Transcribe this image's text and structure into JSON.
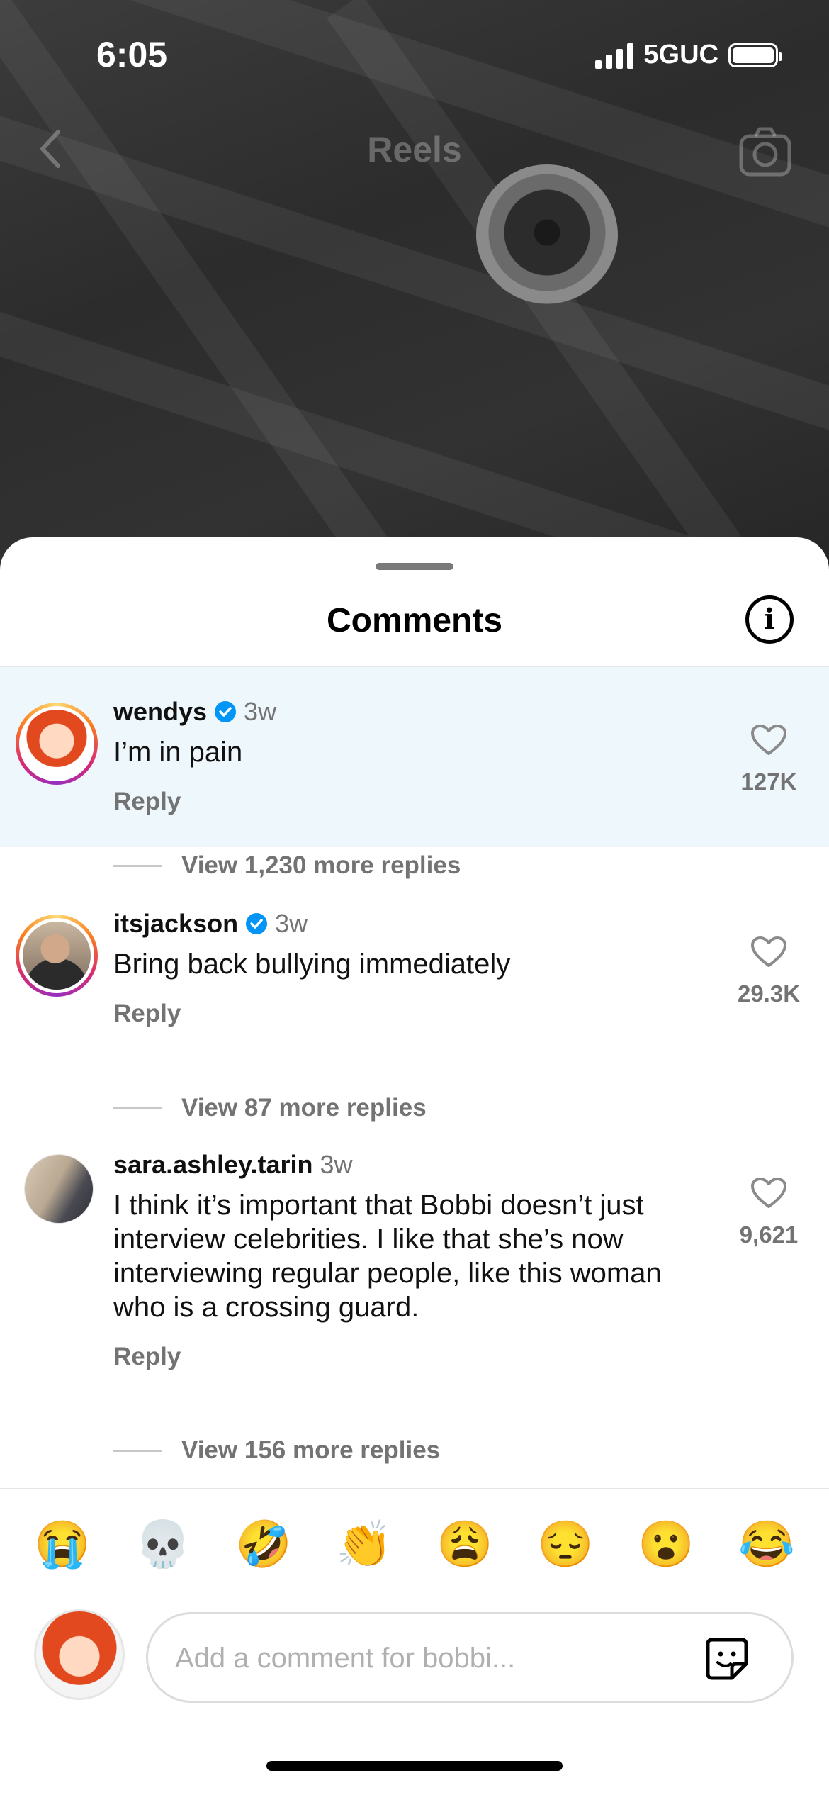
{
  "status_bar": {
    "time": "6:05",
    "network": "5GUC"
  },
  "header": {
    "title": "Reels"
  },
  "sheet": {
    "title": "Comments",
    "comments": [
      {
        "username": "wendys",
        "verified": true,
        "time": "3w",
        "text": "I’m in pain",
        "reply_label": "Reply",
        "likes": "127K",
        "view_more": "View 1,230 more replies"
      },
      {
        "username": "itsjackson",
        "verified": true,
        "time": "3w",
        "text": "Bring back bullying immediately",
        "reply_label": "Reply",
        "likes": "29.3K",
        "view_more": "View 87 more replies"
      },
      {
        "username": "sara.ashley.tarin",
        "verified": false,
        "time": "3w",
        "text": "I think it’s important that Bobbi doesn’t just interview celebrities. I like that she’s now interviewing regular people, like this woman who is a crossing guard.",
        "reply_label": "Reply",
        "likes": "9,621",
        "view_more": "View 156 more replies"
      }
    ],
    "emojis": [
      "😭",
      "💀",
      "🤣",
      "👏",
      "😩",
      "😔",
      "😮",
      "😂"
    ],
    "input_placeholder": "Add a comment for bobbi..."
  },
  "colors": {
    "verified": "#0095f6",
    "highlight": "#eef7fc",
    "muted": "#737373"
  }
}
